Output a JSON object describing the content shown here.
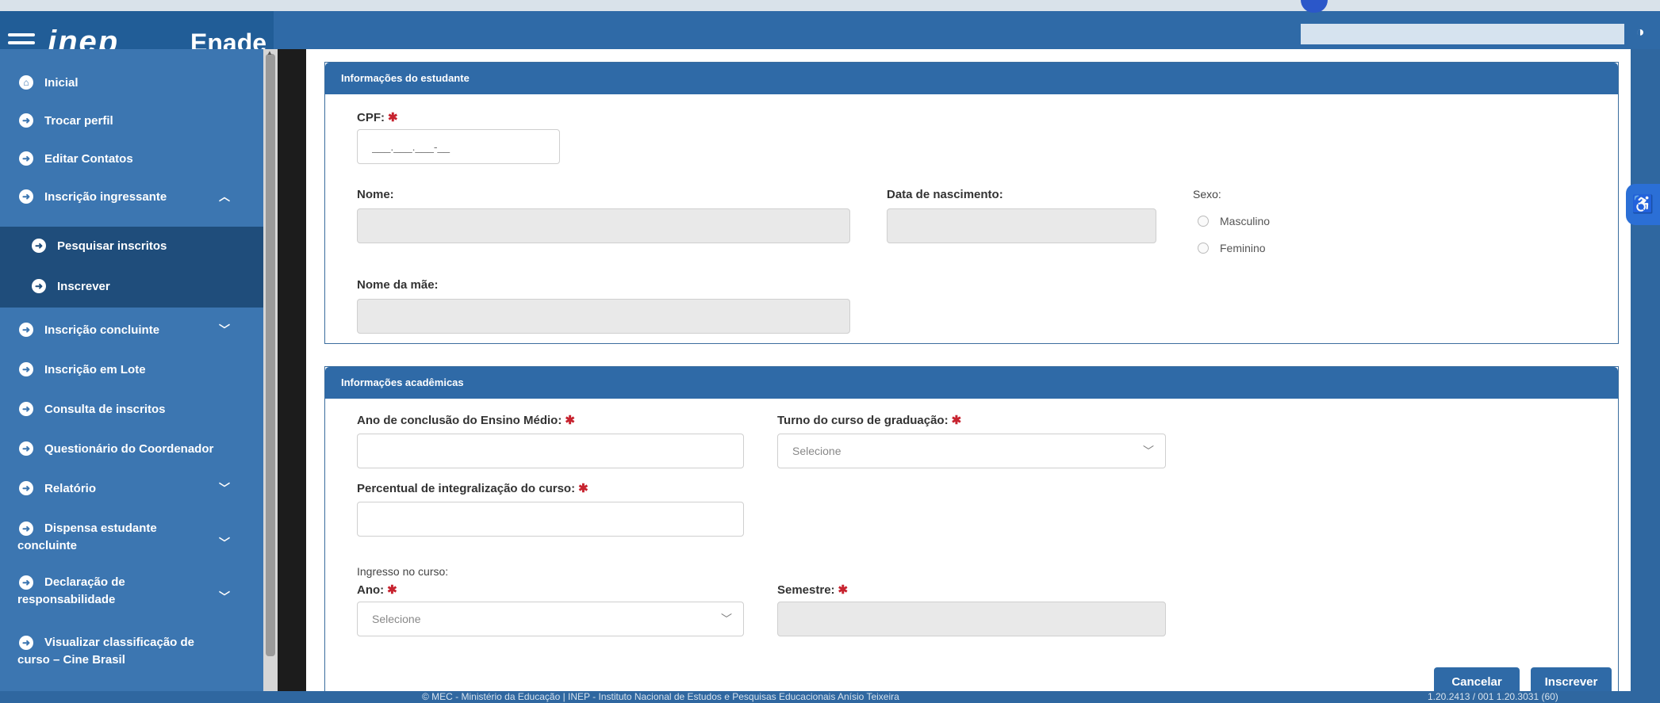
{
  "header": {
    "logo": "inep",
    "app_name": "Enade",
    "search_placeholder": ""
  },
  "sidebar": {
    "items": [
      {
        "label": "Inicial",
        "icon": "home-icon"
      },
      {
        "label": "Trocar perfil",
        "icon": "circle-arrow-icon"
      },
      {
        "label": "Editar Contatos",
        "icon": "circle-arrow-icon"
      },
      {
        "label": "Inscrição ingressante",
        "icon": "circle-arrow-icon",
        "chevron": "^"
      },
      {
        "label": "Pesquisar inscritos",
        "icon": "circle-arrow-icon",
        "sub": true
      },
      {
        "label": "Inscrever",
        "icon": "circle-arrow-icon",
        "sub": true
      },
      {
        "label": "Inscrição concluinte",
        "icon": "circle-arrow-icon",
        "chevron": "v"
      },
      {
        "label": "Inscrição em Lote",
        "icon": "circle-arrow-icon"
      },
      {
        "label": "Consulta de inscritos",
        "icon": "circle-arrow-icon"
      },
      {
        "label": "Questionário do Coordenador",
        "icon": "circle-arrow-icon"
      },
      {
        "label": "Relatório",
        "icon": "circle-arrow-icon",
        "chevron": "v"
      },
      {
        "label_1": "Dispensa estudante",
        "label_2": "concluinte",
        "icon": "circle-arrow-icon",
        "chevron": "v"
      },
      {
        "label_1": "Declaração de",
        "label_2": "responsabilidade",
        "icon": "circle-arrow-icon",
        "chevron": "v"
      },
      {
        "label_1": "Visualizar classificação de",
        "label_2": "curso – Cine Brasil",
        "icon": "circle-arrow-icon"
      }
    ]
  },
  "student_panel": {
    "title": "Informações do estudante",
    "cpf_label": "CPF:",
    "cpf_placeholder": "___.___.___-__",
    "nome_label": "Nome:",
    "nascimento_label": "Data de nascimento:",
    "sexo_label": "Sexo:",
    "sexo_options": [
      "Masculino",
      "Feminino"
    ],
    "mae_label": "Nome da mãe:"
  },
  "academic_panel": {
    "title": "Informações acadêmicas",
    "ano_conclusao_label": "Ano de conclusão do Ensino Médio:",
    "turno_label": "Turno do curso de graduação:",
    "turno_value": "Selecione",
    "percentual_label": "Percentual de integralização do curso:",
    "ingresso_label": "Ingresso no curso:",
    "ano_label": "Ano:",
    "ano_value": "Selecione",
    "semestre_label": "Semestre:"
  },
  "actions": {
    "cancel_label": "Cancelar",
    "submit_label": "Inscrever"
  },
  "footer": {
    "text": "© MEC - Ministério da Educação | INEP - Instituto Nacional de Estudos e Pesquisas Educacionais Anísio Teixeira",
    "version": "1.20.2413 / 001   1.20.3031 (60)"
  },
  "colors": {
    "brand_blue": "#2f6aa7",
    "sidebar_blue": "#3c76b1",
    "sidebar_active": "#1f4d7b",
    "required": "#c7232f"
  }
}
